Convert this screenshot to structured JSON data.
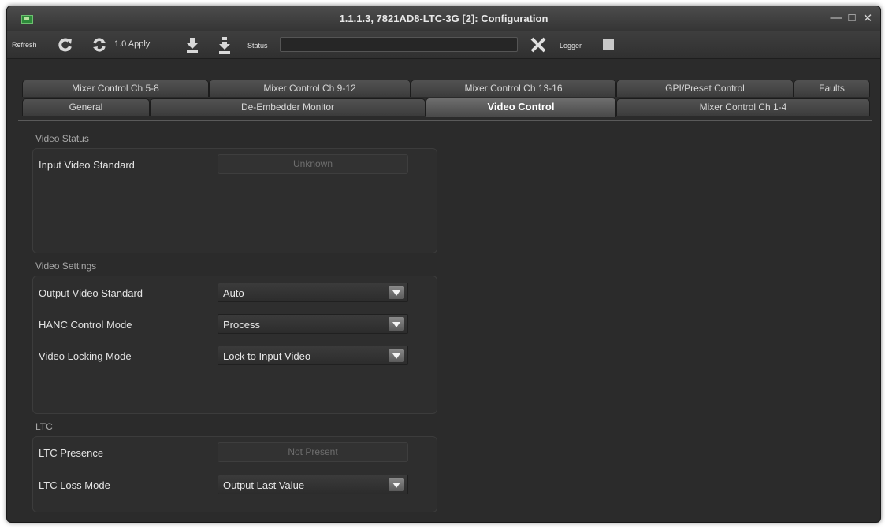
{
  "window": {
    "title": "1.1.1.3, 7821AD8-LTC-3G  [2]: Configuration",
    "icon": "card-icon"
  },
  "toolbar": {
    "refresh_label": "Refresh",
    "apply_label": "1.0 Apply",
    "status_label": "Status",
    "status_value": "",
    "logger_label": "Logger",
    "icons": [
      "refresh-icon",
      "sync-icon",
      "download-icon",
      "download-all-icon",
      "clear-icon",
      "logger-icon"
    ]
  },
  "tabs": {
    "row1": [
      "Mixer Control Ch 5-8",
      "Mixer Control Ch 9-12",
      "Mixer Control Ch 13-16",
      "GPI/Preset Control",
      "Faults"
    ],
    "row2": [
      "General",
      "De-Embedder Monitor",
      "Video Control",
      "Mixer Control Ch 1-4"
    ],
    "active": "Video Control"
  },
  "sections": {
    "video_status": {
      "title": "Video Status",
      "input_video_standard": {
        "label": "Input Video Standard",
        "value": "Unknown"
      }
    },
    "video_settings": {
      "title": "Video Settings",
      "output_video_standard": {
        "label": "Output Video Standard",
        "value": "Auto"
      },
      "hanc_control_mode": {
        "label": "HANC Control Mode",
        "value": "Process"
      },
      "video_locking_mode": {
        "label": "Video Locking Mode",
        "value": "Lock to Input Video"
      }
    },
    "ltc": {
      "title": "LTC",
      "ltc_presence": {
        "label": "LTC Presence",
        "value": "Not Present"
      },
      "ltc_loss_mode": {
        "label": "LTC Loss Mode",
        "value": "Output Last Value"
      }
    }
  },
  "colors": {
    "window_bg": "#2b2b2b",
    "text": "#e4e4e4",
    "section_title": "#a8a8a8",
    "accent_green": "#2d8a3a"
  }
}
